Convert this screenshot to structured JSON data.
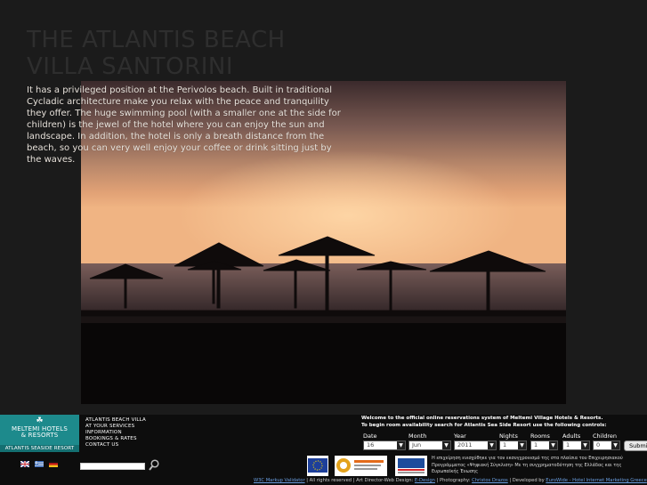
{
  "page": {
    "title_line1": "THE ATLANTIS BEACH",
    "title_line2": "VILLA SANTORINI",
    "intro_text": "It has a privileged position at the Perivolos beach. Built in traditional Cycladic architecture make you relax with the peace and tranquility they offer. The huge swimming pool (with a smaller one at the side for children) is the jewel of the hotel where you can enjoy the sun and landscape. In addition, the hotel is only a breath distance from the beach, so you can very well enjoy your coffee or drink sitting just by the waves."
  },
  "logo": {
    "brand_line1": "MELTEMI HOTELS",
    "brand_line2": "& RESORTS",
    "strip": "ATLANTIS SEASIDE RESORT"
  },
  "nav": {
    "items": [
      "ATLANTIS BEACH VILLA",
      "AT YOUR SERVICES",
      "INFORMATION",
      "BOOKINGS & RATES",
      "CONTACT US"
    ]
  },
  "booking": {
    "welcome": "Welcome to the official online reservations system of Meltemi Village Hotels & Resorts.",
    "instructions": "To begin room availability search for Atlantis Sea Side Resort use the following controls:",
    "labels": {
      "date": "Date",
      "month": "Month",
      "year": "Year",
      "nights": "Nights",
      "rooms": "Rooms",
      "adults": "Adults",
      "children": "Children"
    },
    "values": {
      "date": "16",
      "month": "Jun",
      "year": "2011",
      "nights": "1",
      "rooms": "1",
      "adults": "1",
      "children": "0"
    },
    "submit": "Submit"
  },
  "funding_text": "Η επιχείρηση ενισχύθηκε για τον εκσυγχρονισμό της στα πλαίσια του Επιχειρησιακού Προγράμματος «Ψηφιακή Σύγκλιση» Με τη συγχρηματοδότηση της Ελλάδας και της Ευρωπαϊκής Ένωσης",
  "credits": {
    "w3c": "W3C Markup Validator",
    "rights": " | All rights reserved | Art Director-Web Design: ",
    "design": "E-Design",
    "photo_label": " | Photography: ",
    "photographer": "Christos Drazos",
    "dev_label": " | Developed by ",
    "developer": "EuroWide - Hotel Internet Marketing Greece"
  },
  "colors": {
    "logo_bg": "#1d8a8c",
    "page_bg": "#1b1b1b",
    "footer_bg": "#0d0d0d",
    "link": "#6a9ee0"
  },
  "icons": {
    "search": "magnifier-icon",
    "flags": [
      "english-flag-icon",
      "greek-flag-icon",
      "german-flag-icon"
    ]
  }
}
